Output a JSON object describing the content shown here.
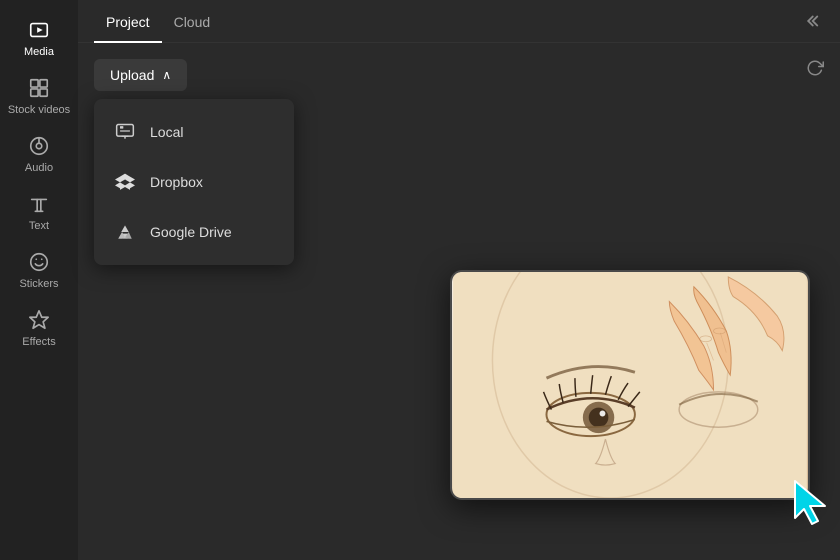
{
  "sidebar": {
    "items": [
      {
        "id": "media",
        "label": "Media",
        "icon": "media",
        "active": true
      },
      {
        "id": "stock-videos",
        "label": "Stock videos",
        "icon": "grid",
        "active": false
      },
      {
        "id": "audio",
        "label": "Audio",
        "icon": "audio",
        "active": false
      },
      {
        "id": "text",
        "label": "Text",
        "icon": "text",
        "active": false
      },
      {
        "id": "stickers",
        "label": "Stickers",
        "icon": "stickers",
        "active": false
      },
      {
        "id": "effects",
        "label": "Effects",
        "icon": "effects",
        "active": false
      }
    ]
  },
  "tabs": {
    "items": [
      {
        "id": "project",
        "label": "Project",
        "active": true
      },
      {
        "id": "cloud",
        "label": "Cloud",
        "active": false
      }
    ],
    "chevron_label": "<<"
  },
  "upload": {
    "button_label": "Upload",
    "chevron": "∧"
  },
  "dropdown": {
    "items": [
      {
        "id": "local",
        "label": "Local",
        "icon": "local"
      },
      {
        "id": "dropbox",
        "label": "Dropbox",
        "icon": "dropbox"
      },
      {
        "id": "google-drive",
        "label": "Google Drive",
        "icon": "google-drive"
      }
    ]
  }
}
